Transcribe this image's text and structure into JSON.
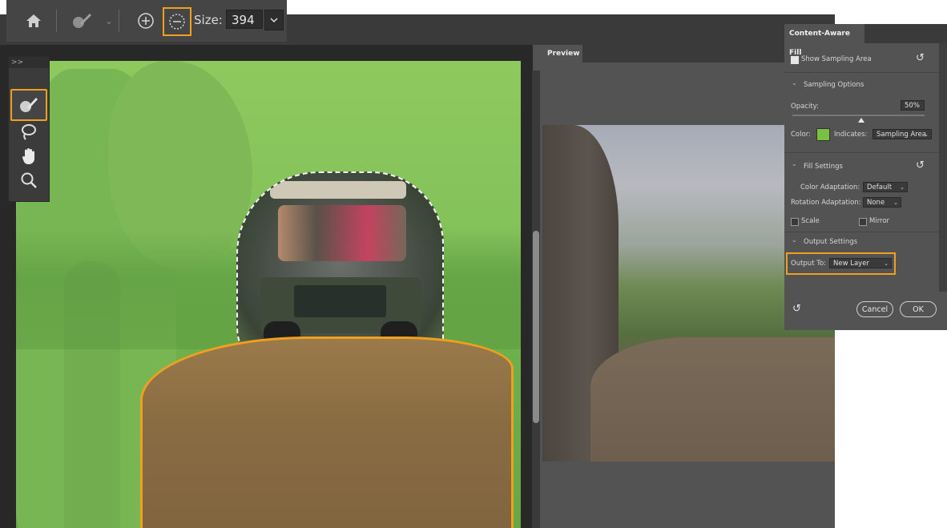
{
  "options_bar": {
    "icons": [
      "home-icon",
      "brush-icon",
      "chevron-down-icon",
      "add-to-selection-icon",
      "subtract-from-selection-icon"
    ],
    "size_label": "Size:",
    "size_value": "394"
  },
  "tools": {
    "header": ">>",
    "items": [
      "sampling-brush-icon",
      "lasso-icon",
      "hand-icon",
      "zoom-icon"
    ]
  },
  "preview": {
    "tab_label": "Preview"
  },
  "caf": {
    "tab_label": "Content-Aware Fill",
    "show_sampling_area": "Show Sampling Area",
    "show_sampling_area_checked": true,
    "sampling_options": "Sampling Options",
    "opacity_label": "Opacity:",
    "opacity_value": "50%",
    "color_label": "Color:",
    "color_value": "#7ac143",
    "indicates_label": "Indicates:",
    "indicates_value": "Sampling Area",
    "fill_settings": "Fill Settings",
    "color_adaptation_label": "Color Adaptation:",
    "color_adaptation_value": "Default",
    "rotation_adaptation_label": "Rotation Adaptation:",
    "rotation_adaptation_value": "None",
    "scale_label": "Scale",
    "mirror_label": "Mirror",
    "output_settings": "Output Settings",
    "output_to_label": "Output To:",
    "output_to_value": "New Layer",
    "cancel_label": "Cancel",
    "ok_label": "OK"
  },
  "colors": {
    "highlight": "#f0a01e",
    "sampling_overlay": "#84c25a"
  }
}
